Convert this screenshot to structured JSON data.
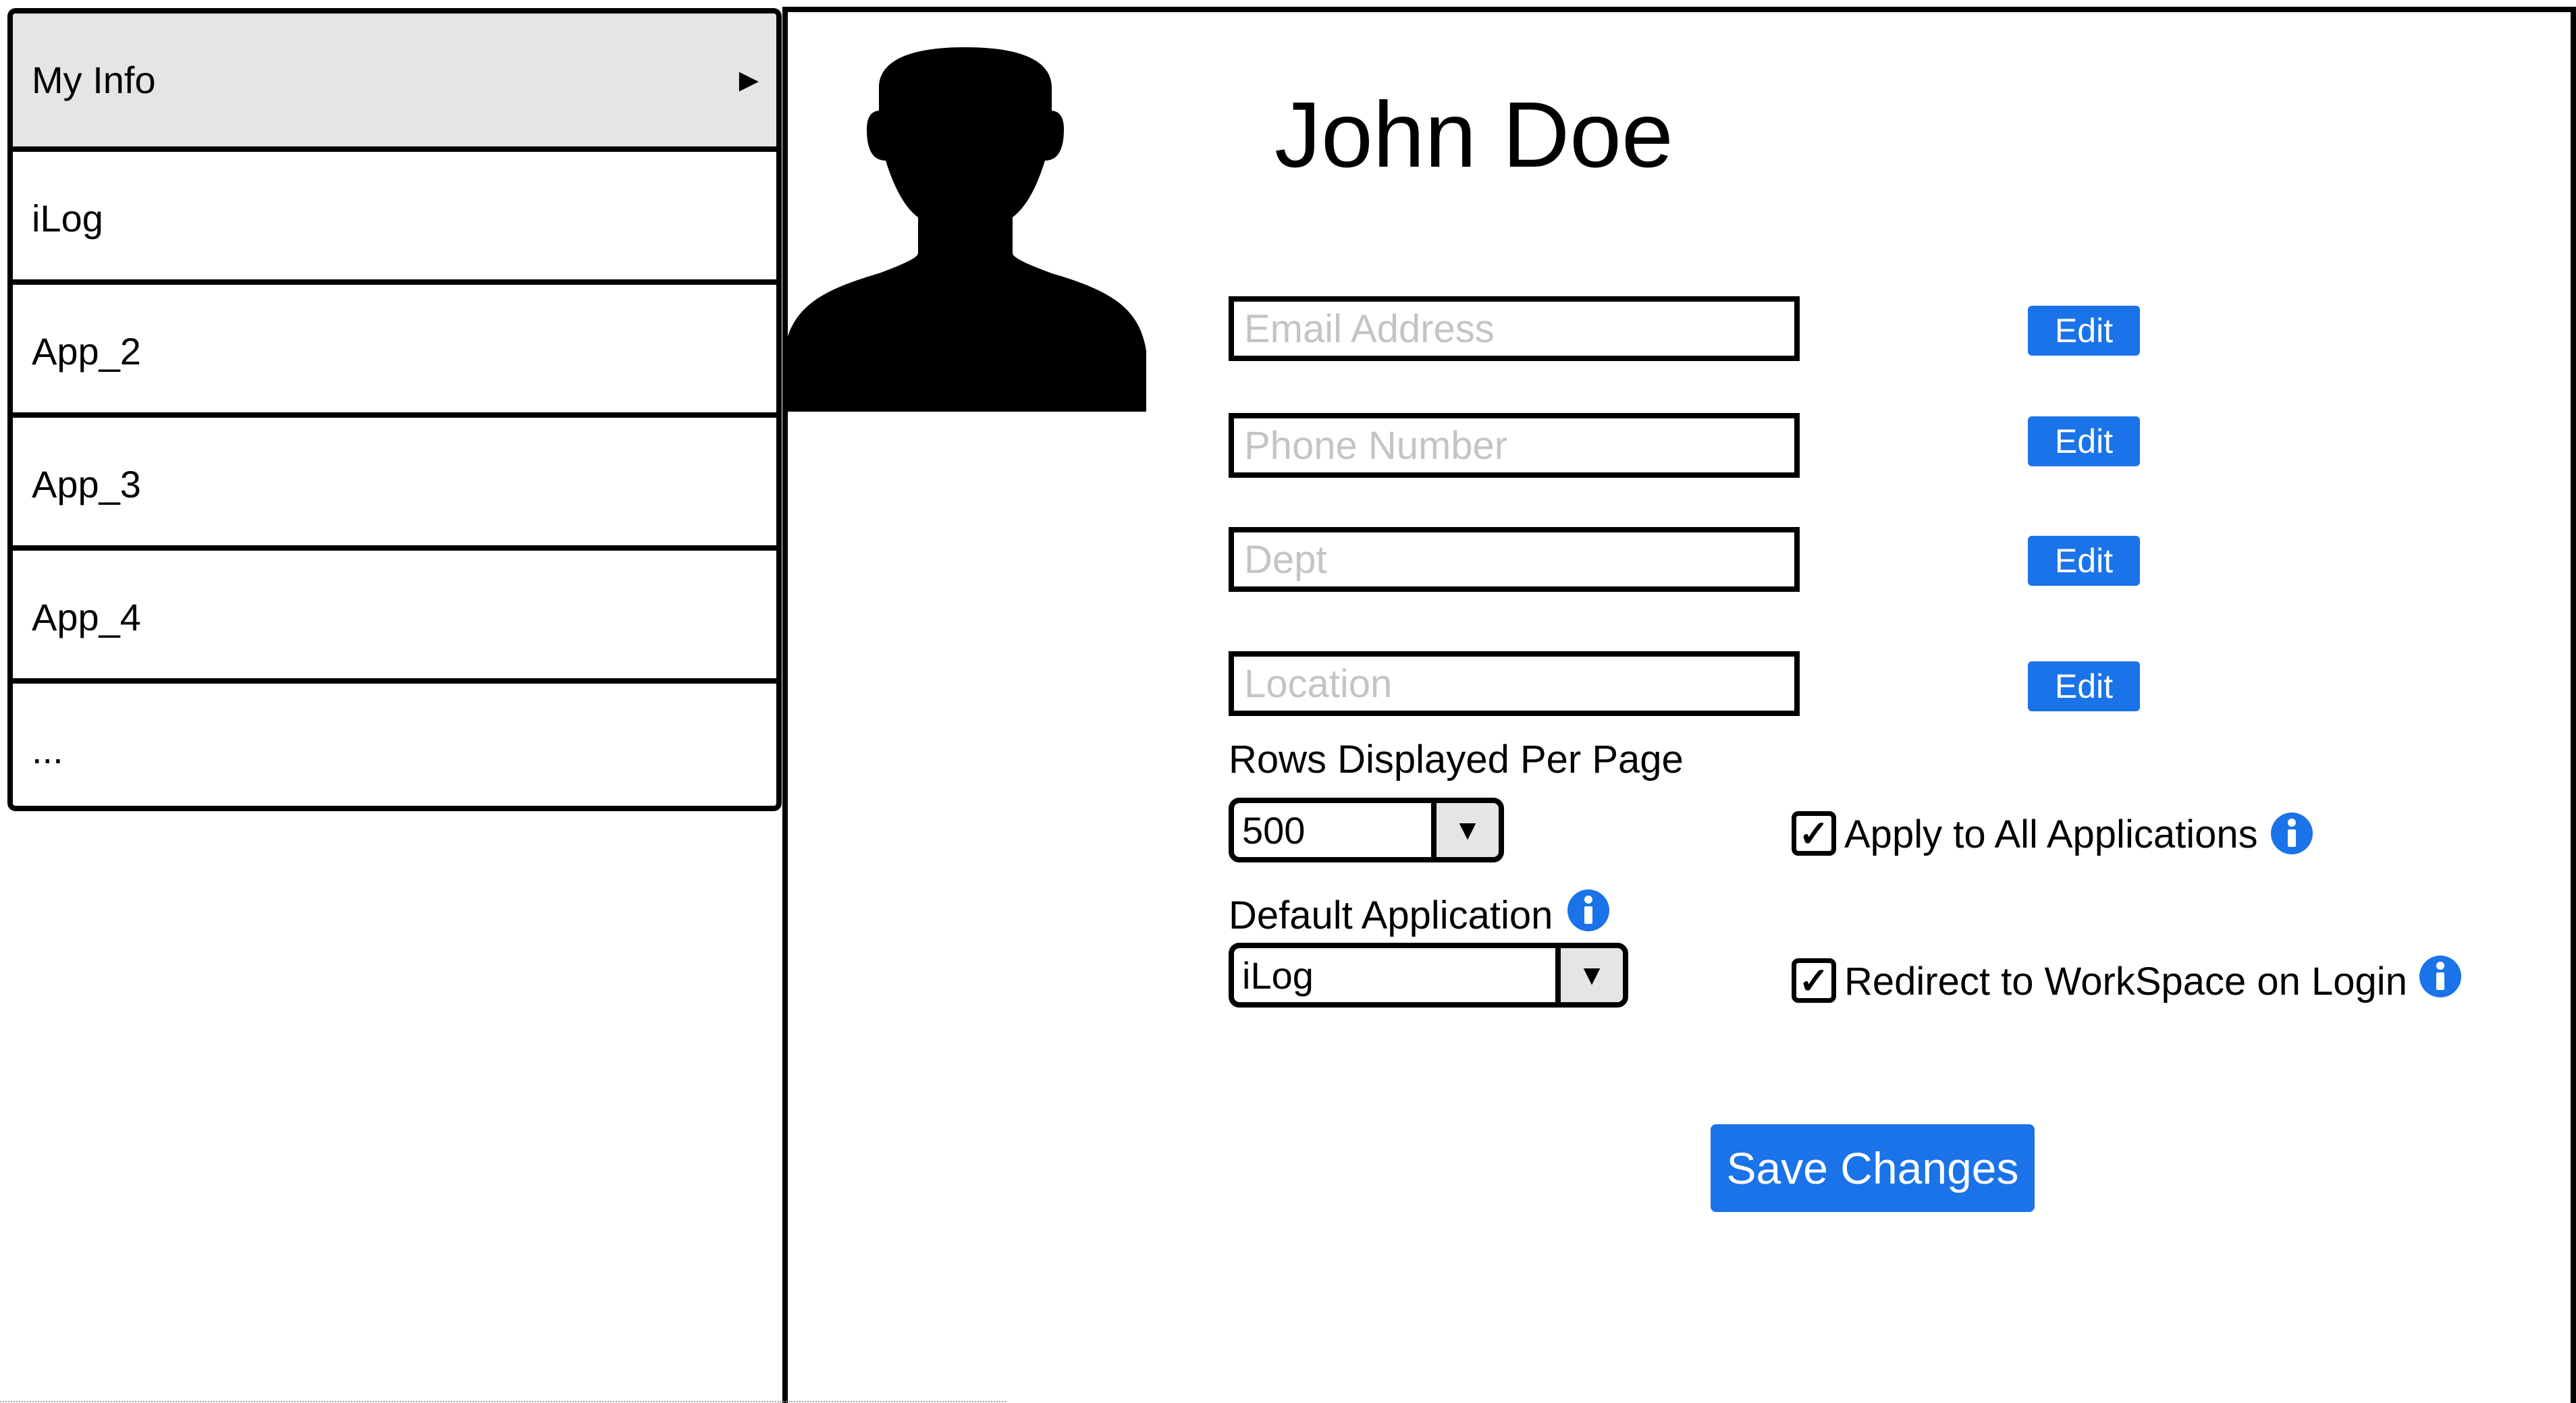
{
  "sidebar": {
    "items": [
      {
        "label": "My Info"
      },
      {
        "label": "iLog"
      },
      {
        "label": "App_2"
      },
      {
        "label": "App_3"
      },
      {
        "label": "App_4"
      },
      {
        "label": "..."
      }
    ],
    "active_arrow": "▶"
  },
  "profile": {
    "name": "John Doe"
  },
  "fields": {
    "email": {
      "placeholder": "Email Address",
      "edit_label": "Edit"
    },
    "phone": {
      "placeholder": "Phone Number",
      "edit_label": "Edit"
    },
    "dept": {
      "placeholder": "Dept",
      "edit_label": "Edit"
    },
    "location": {
      "placeholder": "Location",
      "edit_label": "Edit"
    }
  },
  "rows_per_page": {
    "label": "Rows Displayed Per Page",
    "value": "500",
    "arrow": "▼"
  },
  "default_application": {
    "label": "Default Application",
    "value": "iLog",
    "arrow": "▼"
  },
  "options": {
    "apply_all": {
      "label": "Apply to All Applications",
      "checked": true,
      "mark": "✓"
    },
    "redirect": {
      "label": "Redirect to WorkSpace on Login",
      "checked": true,
      "mark": "✓"
    }
  },
  "actions": {
    "save_label": "Save Changes"
  },
  "colors": {
    "accent": "#1a73e8",
    "active_item_bg": "#e5e5e5",
    "placeholder": "#c4c4c4"
  },
  "icons": {
    "avatar": "person-silhouette-icon",
    "info": "info-icon",
    "dropdown": "chevron-down-icon",
    "check": "checkmark-icon",
    "active": "play-arrow-icon"
  }
}
